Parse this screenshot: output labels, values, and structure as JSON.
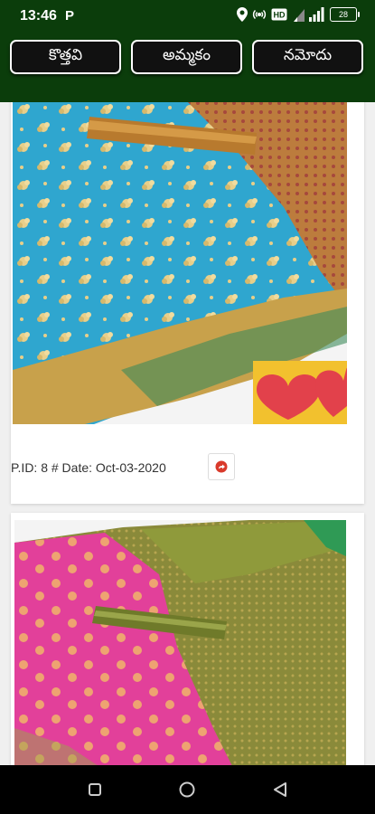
{
  "status": {
    "time": "13:46",
    "badge": "P",
    "battery": "28"
  },
  "tabs": [
    {
      "label": "కొత్తవి"
    },
    {
      "label": "అమ్మకం"
    },
    {
      "label": "నమోదు"
    }
  ],
  "posts": [
    {
      "meta": "P.ID: 8 # Date: Oct-03-2020"
    }
  ],
  "icons": {
    "share": "share-icon",
    "recent": "square-icon",
    "home": "circle-icon",
    "back": "triangle-back-icon"
  }
}
